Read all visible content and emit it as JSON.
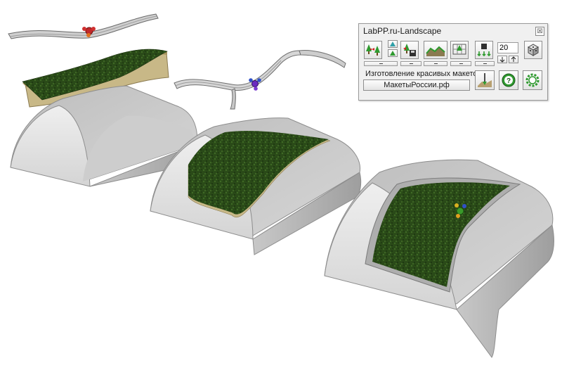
{
  "window": {
    "title": "LabPP.ru-Landscape",
    "close_glyph": "☒"
  },
  "toolbar": {
    "buttons": [
      {
        "name": "trees-export-button",
        "icon": "trees-arrow-icon"
      },
      {
        "name": "tree-save-button",
        "icon": "tree-floppy-icon"
      },
      {
        "name": "terrain-profile-button",
        "icon": "terrain-icon"
      },
      {
        "name": "grid-tree-button",
        "icon": "grid-tree-icon"
      },
      {
        "name": "weight-drop-button",
        "icon": "weight-arrows-icon"
      },
      {
        "name": "dice-button",
        "icon": "dice-icon"
      },
      {
        "name": "shovel-terrain-button",
        "icon": "shovel-icon"
      },
      {
        "name": "help-button",
        "icon": "help-icon"
      },
      {
        "name": "settings-button",
        "icon": "gear-icon"
      }
    ],
    "step_value": "20",
    "caption": "Изготовление красивых макетов",
    "site_link": "МакетыРоссии.рф"
  },
  "scene": {
    "colors": {
      "concrete_light": "#e2e2e2",
      "concrete_mid": "#c4c4c4",
      "concrete_dark": "#a6a6a6",
      "grass_dark": "#213d12",
      "grass_light": "#3f6a25",
      "sand": "#c8b887",
      "handle_red": "#c0282a",
      "handle_blue": "#3050c8",
      "handle_purple": "#6a2bc0",
      "handle_green": "#3a9a2a"
    }
  }
}
